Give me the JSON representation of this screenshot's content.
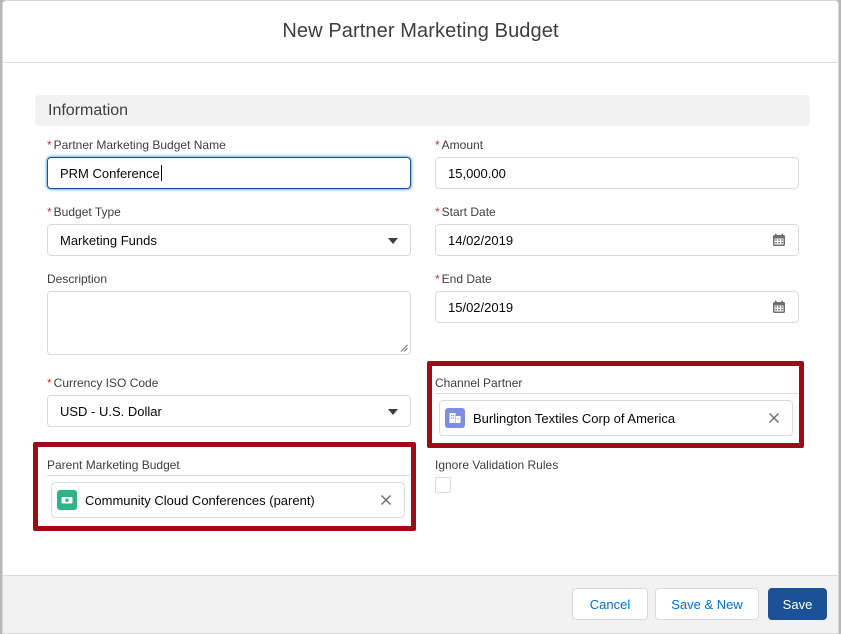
{
  "modal": {
    "title": "New Partner Marketing Budget"
  },
  "section": {
    "title": "Information"
  },
  "fields": {
    "name": {
      "label": "Partner Marketing Budget Name",
      "required": "*",
      "value": "PRM Conference"
    },
    "amount": {
      "label": "Amount",
      "required": "*",
      "value": "15,000.00"
    },
    "budget_type": {
      "label": "Budget Type",
      "required": "*",
      "value": "Marketing Funds"
    },
    "start_date": {
      "label": "Start Date",
      "required": "*",
      "value": "14/02/2019"
    },
    "description": {
      "label": "Description",
      "value": ""
    },
    "end_date": {
      "label": "End Date",
      "required": "*",
      "value": "15/02/2019"
    },
    "currency": {
      "label": "Currency ISO Code",
      "required": "*",
      "value": "USD - U.S. Dollar"
    },
    "channel_partner": {
      "label": "Channel Partner",
      "value": "Burlington Textiles Corp of America",
      "icon": "account-icon"
    },
    "parent_budget": {
      "label": "Parent Marketing Budget",
      "value": "Community Cloud Conferences (parent)",
      "icon": "budget-icon"
    },
    "ignore_validation": {
      "label": "Ignore Validation Rules",
      "checked": false
    }
  },
  "footer": {
    "cancel_label": "Cancel",
    "save_new_label": "Save & New",
    "save_label": "Save"
  },
  "colors": {
    "brand": "#1b5297",
    "required": "#c23934",
    "highlight": "#a00a18",
    "account_icon": "#7f8de1",
    "budget_icon": "#2fb387"
  }
}
